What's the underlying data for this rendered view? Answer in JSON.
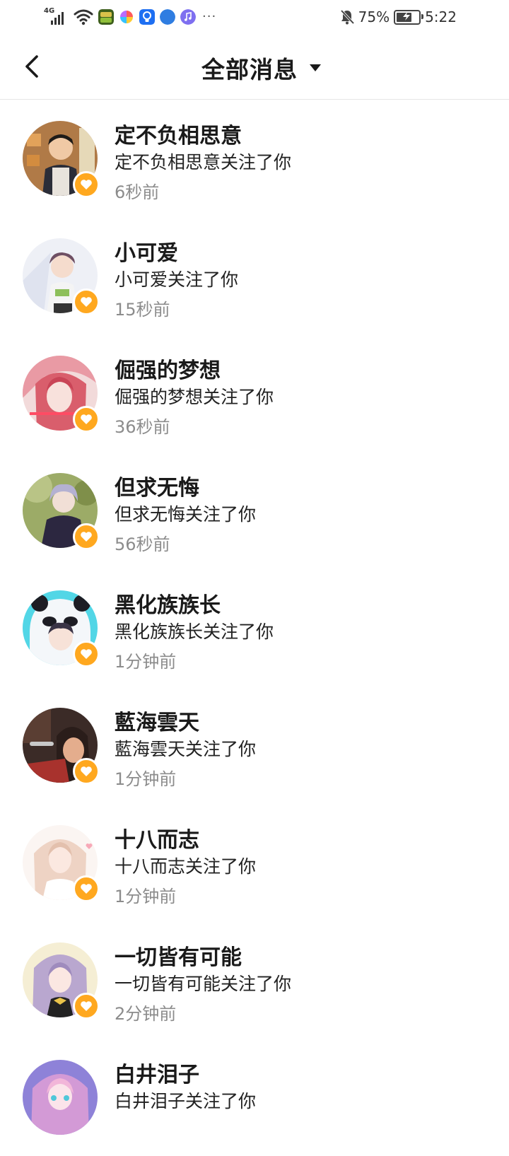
{
  "status_bar": {
    "network": "4G",
    "battery": "75%",
    "battery_level": 0.75,
    "time": "5:22",
    "more": "···"
  },
  "header": {
    "title": "全部消息"
  },
  "colors": {
    "badge": "#ffa81f",
    "time_text": "#8c8c8c"
  },
  "notifications": [
    {
      "name": "定不负相思意",
      "text": "定不负相思意关注了你",
      "time": "6秒前"
    },
    {
      "name": "小可爱",
      "text": "小可爱关注了你",
      "time": "15秒前"
    },
    {
      "name": "倔强的梦想",
      "text": "倔强的梦想关注了你",
      "time": "36秒前"
    },
    {
      "name": "但求无悔",
      "text": "但求无悔关注了你",
      "time": "56秒前"
    },
    {
      "name": "黑化族族长",
      "text": "黑化族族长关注了你",
      "time": "1分钟前"
    },
    {
      "name": "藍海雲天",
      "text": "藍海雲天关注了你",
      "time": "1分钟前"
    },
    {
      "name": "十八而志",
      "text": "十八而志关注了你",
      "time": "1分钟前"
    },
    {
      "name": "一切皆有可能",
      "text": "一切皆有可能关注了你",
      "time": "2分钟前"
    },
    {
      "name": "白井泪子",
      "text": "白井泪子关注了你",
      "time": ""
    }
  ]
}
